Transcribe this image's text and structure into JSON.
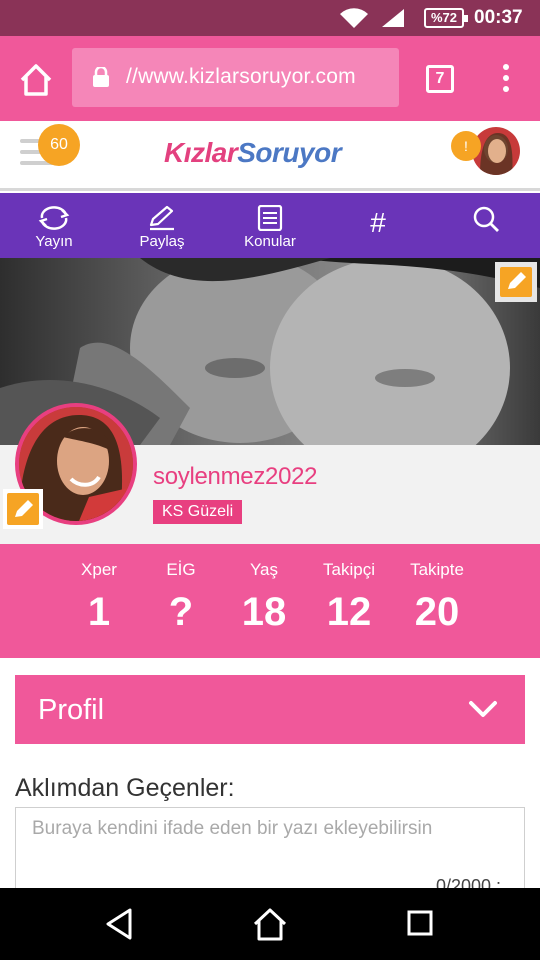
{
  "status_bar": {
    "battery": "%72",
    "time": "00:37"
  },
  "browser": {
    "url": "//www.kizlarsoruyor.com",
    "tab_count": "7"
  },
  "site_header": {
    "notification_count": "60",
    "logo_part1": "Kızlar",
    "logo_part2": "Soruyor",
    "alert_badge": "!"
  },
  "nav": {
    "items": [
      {
        "label": "Yayın",
        "icon": "refresh-icon"
      },
      {
        "label": "Paylaş",
        "icon": "pencil-icon"
      },
      {
        "label": "Konular",
        "icon": "document-icon"
      },
      {
        "label": "#",
        "icon": "hashtag-icon"
      },
      {
        "label": "",
        "icon": "search-icon"
      }
    ]
  },
  "profile": {
    "username": "soylenmez2022",
    "rank": "KS Güzeli"
  },
  "stats": [
    {
      "label": "Xper",
      "value": "1"
    },
    {
      "label": "EİG",
      "value": "?"
    },
    {
      "label": "Yaş",
      "value": "18"
    },
    {
      "label": "Takipçi",
      "value": "12"
    },
    {
      "label": "Takipte",
      "value": "20"
    }
  ],
  "profile_section": {
    "title": "Profil"
  },
  "thoughts": {
    "label": "Aklımdan Geçenler:",
    "placeholder": "Buraya kendini ifade eden bir yazı ekleyebilirsin",
    "char_count": "0/2000 :"
  },
  "colors": {
    "brand_pink": "#f0589a",
    "deep_pink": "#e83f80",
    "nav_purple": "#6a34b8",
    "badge_orange": "#f6a424",
    "status_bar": "#8a3357"
  }
}
